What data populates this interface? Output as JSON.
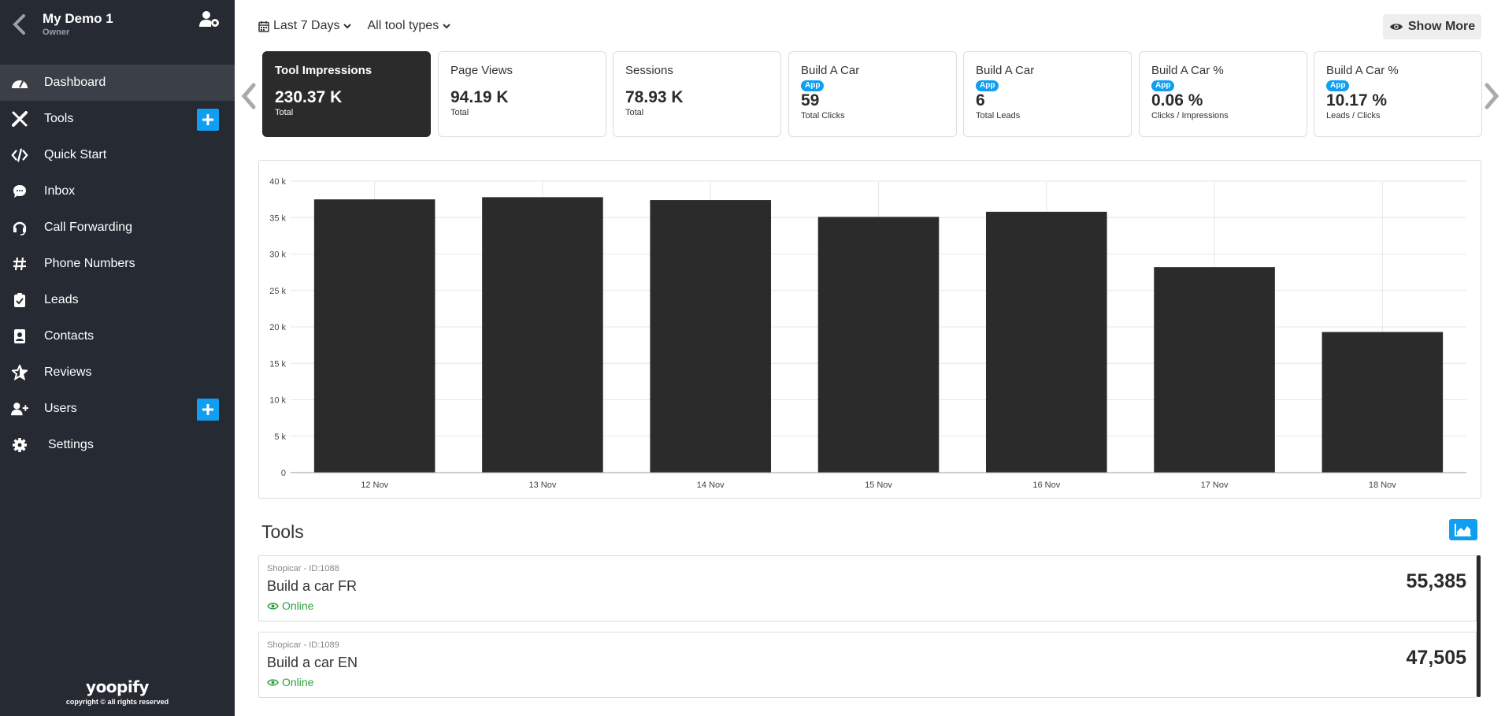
{
  "account": {
    "name": "My Demo 1",
    "role": "Owner"
  },
  "sidebar": {
    "items": [
      {
        "label": "Dashboard",
        "icon": "dashboard-icon",
        "active": true
      },
      {
        "label": "Tools",
        "icon": "tools-icon",
        "plus": true
      },
      {
        "label": "Quick Start",
        "icon": "code-icon"
      },
      {
        "label": "Inbox",
        "icon": "sms-icon"
      },
      {
        "label": "Call Forwarding",
        "icon": "headset-icon"
      },
      {
        "label": "Phone Numbers",
        "icon": "hashtag-icon"
      },
      {
        "label": "Leads",
        "icon": "clipboard-check-icon"
      },
      {
        "label": "Contacts",
        "icon": "contact-book-icon"
      },
      {
        "label": "Reviews",
        "icon": "star-icon"
      },
      {
        "label": "Users",
        "icon": "user-plus-icon",
        "plus": true
      },
      {
        "label": "Settings",
        "icon": "gear-icon"
      }
    ],
    "footer": {
      "logo": "yoopify",
      "copyright": "copyright © all rights reserved"
    }
  },
  "filters": {
    "date": "Last 7 Days",
    "type": "All tool types"
  },
  "show_more": "Show More",
  "cards": [
    {
      "label": "Tool Impressions",
      "value": "230.37 K",
      "sub": "Total",
      "active": true
    },
    {
      "label": "Page Views",
      "value": "94.19 K",
      "sub": "Total"
    },
    {
      "label": "Sessions",
      "value": "78.93 K",
      "sub": "Total"
    },
    {
      "label": "Build A Car",
      "badge": "App",
      "value": "59",
      "sub": "Total Clicks"
    },
    {
      "label": "Build A Car",
      "badge": "App",
      "value": "6",
      "sub": "Total Leads"
    },
    {
      "label": "Build A Car %",
      "badge": "App",
      "value": "0.06 %",
      "sub": "Clicks / Impressions"
    },
    {
      "label": "Build A Car %",
      "badge": "App",
      "value": "10.17 %",
      "sub": "Leads / Clicks"
    }
  ],
  "chart_data": {
    "type": "bar",
    "categories": [
      "12 Nov",
      "13 Nov",
      "14 Nov",
      "15 Nov",
      "16 Nov",
      "17 Nov",
      "18 Nov"
    ],
    "values": [
      37500,
      37800,
      37400,
      35100,
      35800,
      28200,
      19300
    ],
    "yticks": [
      "0",
      "5 k",
      "10 k",
      "15 k",
      "20 k",
      "25 k",
      "30 k",
      "35 k",
      "40 k"
    ],
    "ylim": [
      0,
      40000
    ],
    "bar_color": "#2b2b2b",
    "grid": true
  },
  "tools_section": {
    "title": "Tools",
    "rows": [
      {
        "meta": "Shopicar - ID:1088",
        "name": "Build a car FR",
        "status": "Online",
        "value": "55,385"
      },
      {
        "meta": "Shopicar - ID:1089",
        "name": "Build a car EN",
        "status": "Online",
        "value": "47,505"
      }
    ]
  },
  "colors": {
    "sidebar": "#262a33",
    "accent": "#0f9ef0",
    "online": "#2e9e3e",
    "dark": "#2b2b2b"
  }
}
